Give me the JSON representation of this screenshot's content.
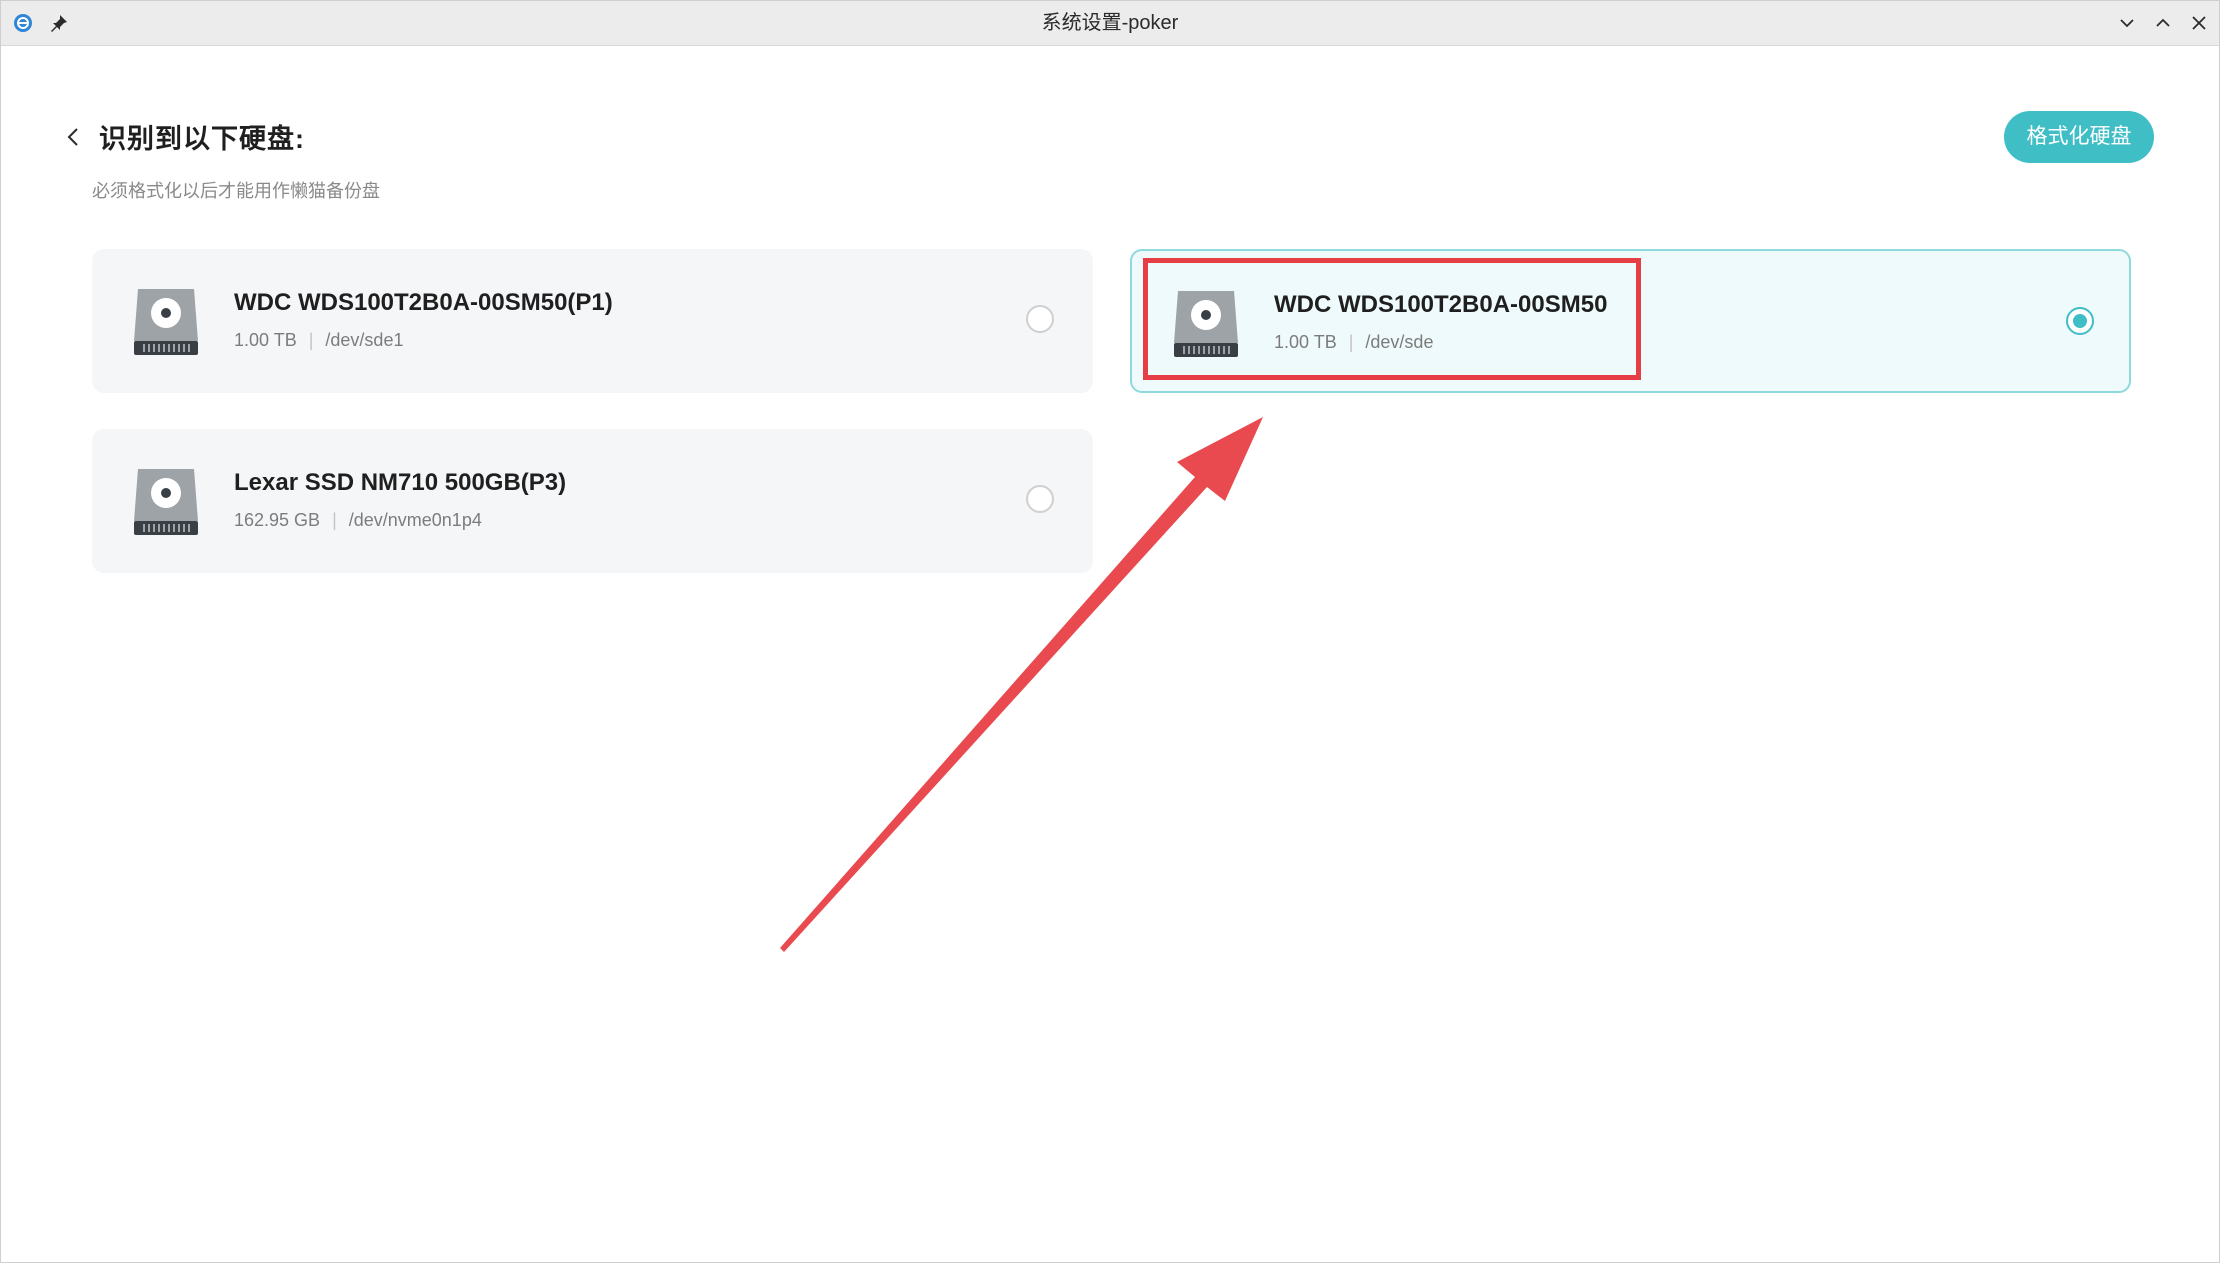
{
  "window": {
    "title": "系统设置-poker"
  },
  "header": {
    "title": "识别到以下硬盘:",
    "subtitle": "必须格式化以后才能用作懒猫备份盘",
    "format_button_label": "格式化硬盘"
  },
  "disks": [
    {
      "name": "WDC WDS100T2B0A-00SM50(P1)",
      "size": "1.00 TB",
      "separator": "|",
      "device": "/dev/sde1",
      "selected": false
    },
    {
      "name": "WDC WDS100T2B0A-00SM50",
      "size": "1.00 TB",
      "separator": "|",
      "device": "/dev/sde",
      "selected": true
    },
    {
      "name": "Lexar SSD NM710 500GB(P3)",
      "size": "162.95 GB",
      "separator": "|",
      "device": "/dev/nvme0n1p4",
      "selected": false
    }
  ],
  "colors": {
    "accent": "#3fbec6",
    "annotation": "#e53e44"
  },
  "icons": {
    "app": "app-icon",
    "pin": "pin-icon",
    "back": "chevron-left-icon",
    "disk": "hard-disk-icon",
    "minimize": "chevron-down-icon",
    "maximize": "chevron-up-icon",
    "close": "close-icon"
  }
}
